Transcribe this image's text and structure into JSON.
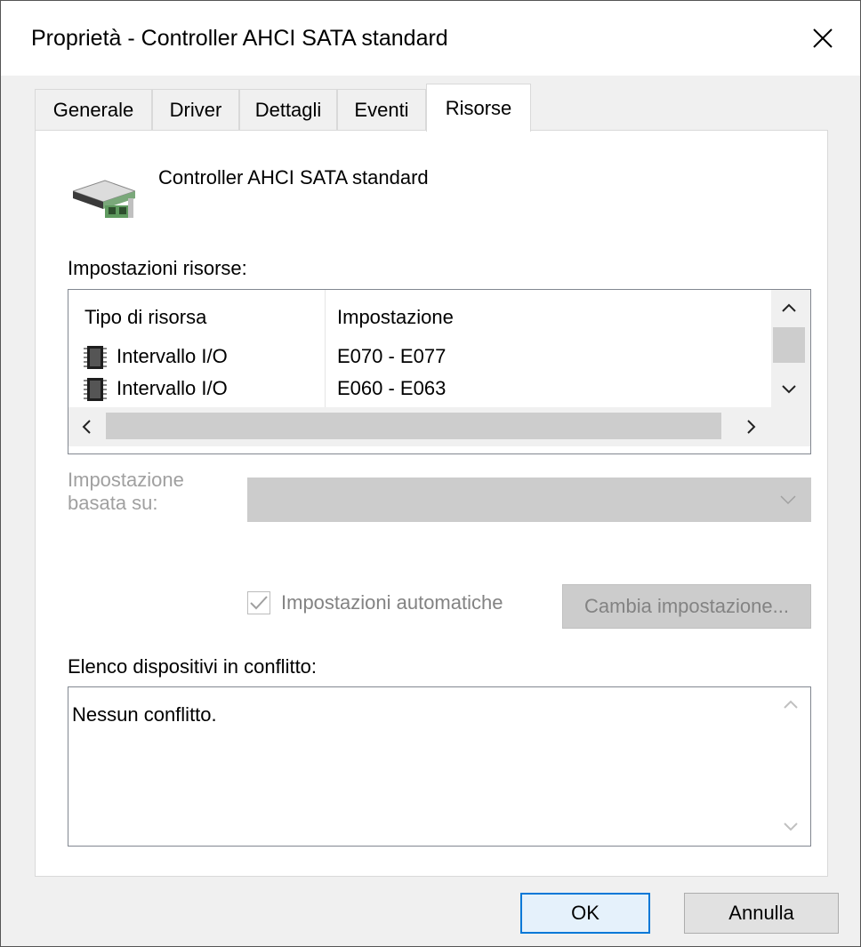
{
  "window": {
    "title": "Proprietà - Controller AHCI SATA standard"
  },
  "tabs": [
    {
      "label": "Generale"
    },
    {
      "label": "Driver"
    },
    {
      "label": "Dettagli"
    },
    {
      "label": "Eventi"
    },
    {
      "label": "Risorse"
    }
  ],
  "selected_tab": "Risorse",
  "device": {
    "name": "Controller AHCI SATA standard",
    "icon": "controller-card-icon"
  },
  "resources": {
    "label": "Impostazioni risorse:",
    "columns": [
      "Tipo di risorsa",
      "Impostazione"
    ],
    "rows": [
      {
        "type": "Intervallo I/O",
        "setting": "E070 - E077",
        "icon": "chip-icon"
      },
      {
        "type": "Intervallo I/O",
        "setting": "E060 - E063",
        "icon": "chip-icon"
      }
    ]
  },
  "based_on": {
    "label_line1": "Impostazione",
    "label_line2": "basata su:",
    "value": ""
  },
  "auto_settings": {
    "label": "Impostazioni automatiche",
    "checked": true
  },
  "change_setting_button": "Cambia impostazione...",
  "conflicts": {
    "label": "Elenco dispositivi in conflitto:",
    "text": "Nessun conflitto."
  },
  "footer": {
    "ok": "OK",
    "cancel": "Annulla"
  },
  "colors": {
    "accent": "#0078d7",
    "disabled_text": "#a0a0a0"
  }
}
